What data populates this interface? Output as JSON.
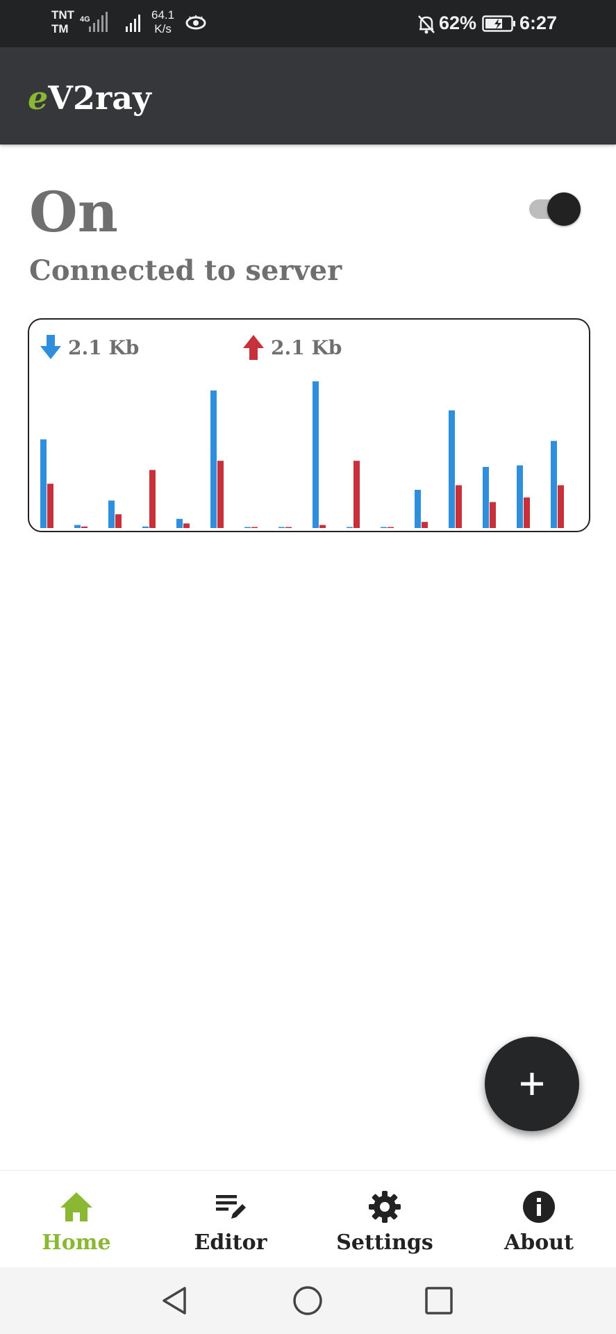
{
  "status_bar": {
    "carrier_line1": "TNT",
    "carrier_line2": "TM",
    "network_type": "4G",
    "speed_value": "64.1",
    "speed_unit": "K/s",
    "battery_percent": "62%",
    "time": "6:27"
  },
  "app_bar": {
    "title_prefix": "e",
    "title_rest": "V2ray"
  },
  "connection": {
    "state_title": "On",
    "state_subtitle": "Connected to server",
    "toggle_on": true
  },
  "traffic": {
    "download_label": "2.1 Kb",
    "upload_label": "2.1 Kb"
  },
  "chart_data": {
    "type": "bar",
    "series": [
      {
        "color": "#2f8fdc",
        "values": [
          0.58,
          0.02,
          0.18,
          0.01,
          0.06,
          0.9,
          0.0,
          0.0,
          0.96,
          0.0,
          0.0,
          0.25,
          0.77,
          0.4,
          0.41,
          0.57
        ]
      },
      {
        "color": "#c7323a",
        "values": [
          0.29,
          0.01,
          0.09,
          0.38,
          0.03,
          0.44,
          0.0,
          0.0,
          0.02,
          0.44,
          0.0,
          0.04,
          0.28,
          0.17,
          0.2,
          0.28
        ]
      }
    ],
    "grid": false,
    "legend": "top-left"
  },
  "fab": {
    "icon": "plus-icon"
  },
  "bottom_nav": {
    "items": [
      {
        "label": "Home",
        "icon": "home-icon",
        "active": true
      },
      {
        "label": "Editor",
        "icon": "edit-icon",
        "active": false
      },
      {
        "label": "Settings",
        "icon": "gear-icon",
        "active": false
      },
      {
        "label": "About",
        "icon": "info-icon",
        "active": false
      }
    ]
  },
  "colors": {
    "accent": "#8bb832",
    "download": "#2f8fdc",
    "upload": "#c7323a",
    "app_bar": "#35373b",
    "status_bar": "#222325"
  }
}
